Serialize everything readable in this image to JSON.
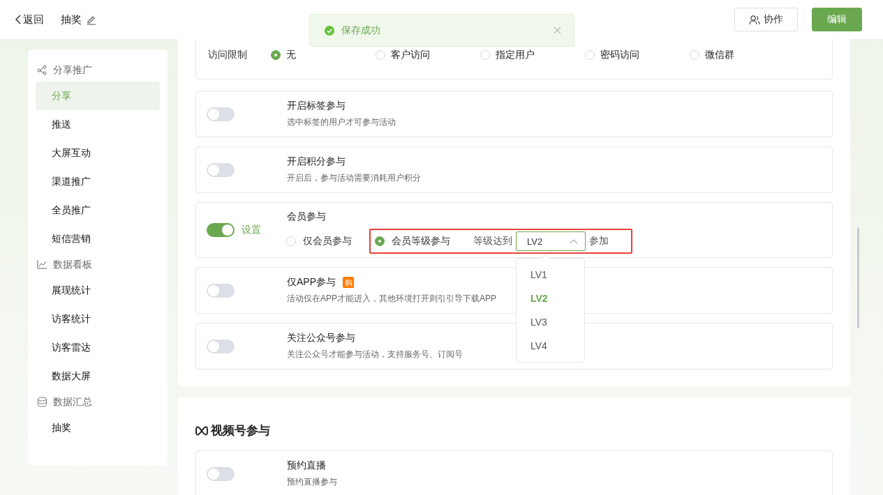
{
  "header": {
    "back": "返回",
    "title": "抽奖",
    "buttons": [
      {
        "label": "协作",
        "kind": "outline"
      },
      {
        "label": "编辑",
        "kind": "primary"
      }
    ]
  },
  "toast": {
    "message": "保存成功"
  },
  "sidebar": {
    "groups": [
      {
        "label": "分享推广",
        "items": [
          {
            "label": "分享",
            "selected": true
          },
          {
            "label": "推送",
            "selected": false
          },
          {
            "label": "大屏互动",
            "selected": false
          },
          {
            "label": "渠道推广",
            "selected": false
          },
          {
            "label": "全员推广",
            "selected": false
          },
          {
            "label": "短信营销",
            "selected": false
          }
        ]
      },
      {
        "label": "数据看板",
        "items": [
          {
            "label": "展现统计",
            "selected": false
          },
          {
            "label": "访客统计",
            "selected": false
          },
          {
            "label": "访客雷达",
            "selected": false
          },
          {
            "label": "数据大屏",
            "selected": false
          }
        ]
      },
      {
        "label": "数据汇总",
        "items": [
          {
            "label": "抽奖",
            "selected": false
          }
        ]
      }
    ]
  },
  "access_limit": {
    "label": "访问限制",
    "options": [
      {
        "label": "无",
        "selected": true
      },
      {
        "label": "客户访问",
        "selected": false
      },
      {
        "label": "指定用户",
        "selected": false
      },
      {
        "label": "密码访问",
        "selected": false
      },
      {
        "label": "微信群",
        "selected": false
      }
    ]
  },
  "settings": [
    {
      "kind": "toggle",
      "title": "开启标签参与",
      "description": "选中标签的用户才可参与活动",
      "on": false
    },
    {
      "kind": "toggle",
      "title": "开启积分参与",
      "description": "开启后，参与活动需要消耗用户积分",
      "on": false
    },
    {
      "kind": "member",
      "title": "会员参与",
      "on": true,
      "link": "设置",
      "options": [
        {
          "label": "仅会员参与",
          "selected": false
        },
        {
          "label": "会员等级参与",
          "selected": true
        }
      ],
      "level_label": "等级达到",
      "select": {
        "value": "LV2",
        "expanded": true,
        "options": [
          {
            "label": "LV1",
            "selected": false
          },
          {
            "label": "LV2",
            "selected": true
          },
          {
            "label": "LV3",
            "selected": false
          },
          {
            "label": "LV4",
            "selected": false
          }
        ]
      },
      "suffix": "参加",
      "highlighted": true
    },
    {
      "kind": "toggle",
      "title": "仅APP参与",
      "badge": "购",
      "description": "活动仅在APP才能进入，其他环境打开则引引导下载APP",
      "on": false
    },
    {
      "kind": "toggle",
      "title": "关注公众号参与",
      "description": "关注公众号才能参与活动，支持服务号、订阅号",
      "on": false
    }
  ],
  "channels_section": {
    "title": "视频号参与",
    "settings": [
      {
        "kind": "toggle",
        "title": "预约直播",
        "description": "预约直播参与",
        "on": false
      }
    ]
  }
}
